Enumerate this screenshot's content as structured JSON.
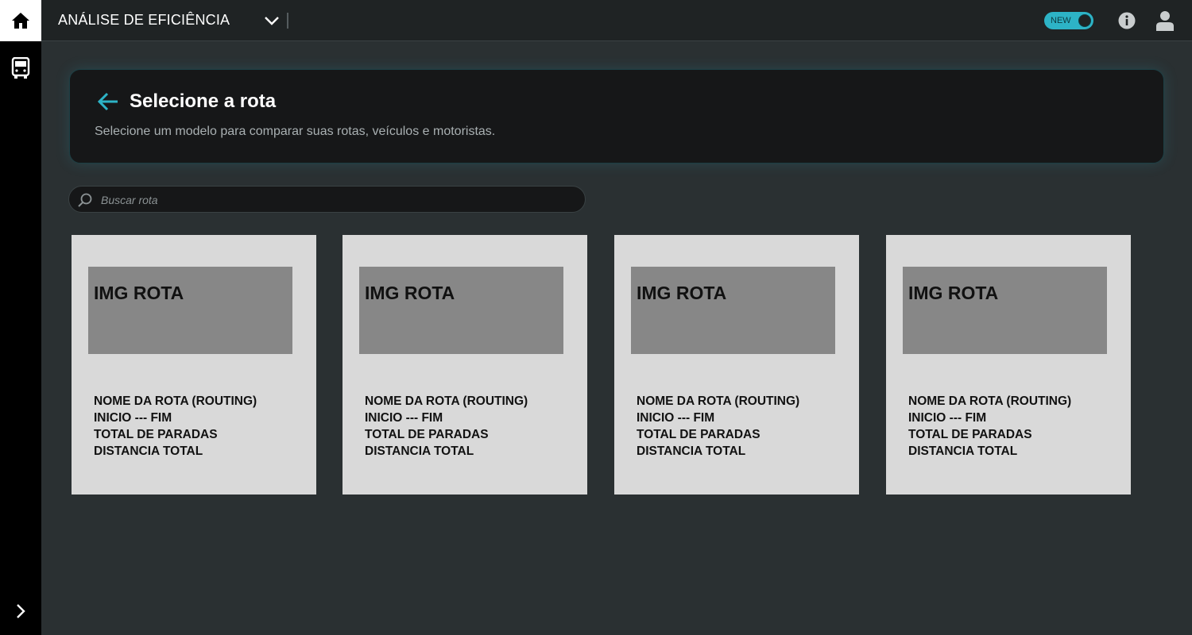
{
  "topbar": {
    "title": "ANÁLISE DE EFICIÊNCIA",
    "toggle_label": "NEW",
    "accent_color": "#2db3c6"
  },
  "sidebar": {
    "items": [
      {
        "icon": "home-icon",
        "active": true
      },
      {
        "icon": "bus-icon",
        "active": false
      }
    ],
    "expand_icon": "chevron-right-icon"
  },
  "header": {
    "title": "Selecione a rota",
    "subtitle": "Selecione um modelo para comparar suas rotas, veículos e motoristas."
  },
  "search": {
    "placeholder": "Buscar rota",
    "value": ""
  },
  "cards": [
    {
      "image_label": "IMG ROTA",
      "route_name": "NOME DA ROTA (ROUTING)",
      "start_end": "INICIO --- FIM",
      "total_stops": "TOTAL DE PARADAS",
      "total_distance": "DISTANCIA TOTAL"
    },
    {
      "image_label": "IMG ROTA",
      "route_name": "NOME DA ROTA (ROUTING)",
      "start_end": "INICIO --- FIM",
      "total_stops": "TOTAL DE PARADAS",
      "total_distance": "DISTANCIA TOTAL"
    },
    {
      "image_label": "IMG ROTA",
      "route_name": "NOME DA ROTA (ROUTING)",
      "start_end": "INICIO --- FIM",
      "total_stops": "TOTAL DE PARADAS",
      "total_distance": "DISTANCIA TOTAL"
    },
    {
      "image_label": "IMG ROTA",
      "route_name": "NOME DA ROTA (ROUTING)",
      "start_end": "INICIO --- FIM",
      "total_stops": "TOTAL DE PARADAS",
      "total_distance": "DISTANCIA TOTAL"
    }
  ]
}
